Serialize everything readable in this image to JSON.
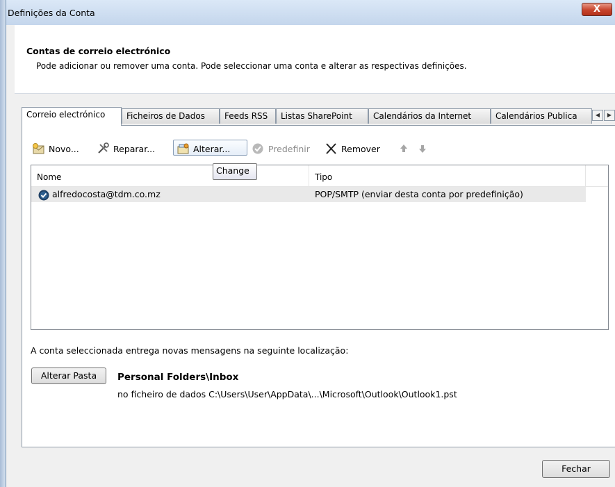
{
  "window": {
    "title": "Definições da Conta",
    "close_glyph": "X"
  },
  "header": {
    "title": "Contas de correio electrónico",
    "subtitle": "Pode adicionar ou remover uma conta. Pode seleccionar uma conta e alterar as respectivas definições."
  },
  "tabs": [
    {
      "label": "Correio electrónico",
      "active": true
    },
    {
      "label": "Ficheiros de Dados"
    },
    {
      "label": "Feeds RSS"
    },
    {
      "label": "Listas SharePoint"
    },
    {
      "label": "Calendários da Internet"
    },
    {
      "label": "Calendários Publica"
    }
  ],
  "toolbar": {
    "novo": "Novo...",
    "reparar": "Reparar...",
    "alterar": "Alterar...",
    "predefinir": "Predefinir",
    "remover": "Remover"
  },
  "tooltip": "Change",
  "list": {
    "columns": [
      "Nome",
      "Tipo"
    ],
    "rows": [
      {
        "name": "alfredocosta@tdm.co.mz",
        "type": "POP/SMTP (enviar desta conta por predefinição)"
      }
    ]
  },
  "location": {
    "label": "A conta seleccionada entrega novas mensagens na seguinte localização:",
    "button": "Alterar Pasta",
    "folder": "Personal Folders\\Inbox",
    "path": "no ficheiro de dados C:\\Users\\User\\AppData\\...\\Microsoft\\Outlook\\Outlook1.pst"
  },
  "footer": {
    "close_button": "Fechar"
  },
  "colors": {
    "titlebar": "#c4d6ec",
    "close": "#c7442c",
    "selected_row": "#e9e9e9"
  }
}
